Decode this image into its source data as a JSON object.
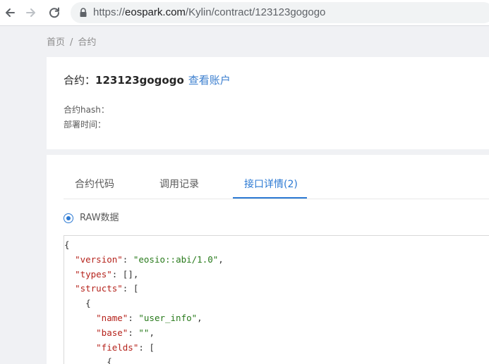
{
  "browser": {
    "url_prefix": "https://",
    "url_host": "eospark.com",
    "url_path": "/Kylin/contract/123123gogogo"
  },
  "breadcrumb": {
    "home": "首页",
    "separator": "/",
    "current": "合约"
  },
  "contract": {
    "label": "合约：",
    "name": "123123gogogo",
    "view_account_link": "查看账户",
    "hash_label": "合约hash：",
    "deploy_time_label": "部署时间："
  },
  "tabs": [
    {
      "label": "合约代码"
    },
    {
      "label": "调用记录"
    },
    {
      "label": "接口详情(2)"
    }
  ],
  "raw_option": {
    "label": "RAW数据"
  },
  "code": {
    "line0": "{",
    "line1": {
      "key": "\"version\"",
      "colon": ": ",
      "value": "\"eosio::abi/1.0\"",
      "end": ","
    },
    "line2": {
      "key": "\"types\"",
      "rest": ": [],"
    },
    "line3": {
      "key": "\"structs\"",
      "rest": ": ["
    },
    "line4": "{",
    "line5": {
      "key": "\"name\"",
      "colon": ": ",
      "value": "\"user_info\"",
      "end": ","
    },
    "line6": {
      "key": "\"base\"",
      "colon": ": ",
      "value": "\"\"",
      "end": ","
    },
    "line7": {
      "key": "\"fields\"",
      "rest": ": ["
    },
    "line8": "{"
  },
  "colors": {
    "accent": "#2b79d3",
    "link": "#3c7fcf",
    "json_key": "#b5231c",
    "json_string": "#287a1b"
  },
  "icons": {
    "back": "arrow-left-icon",
    "forward": "arrow-right-icon",
    "reload": "reload-icon",
    "lock": "lock-icon"
  }
}
